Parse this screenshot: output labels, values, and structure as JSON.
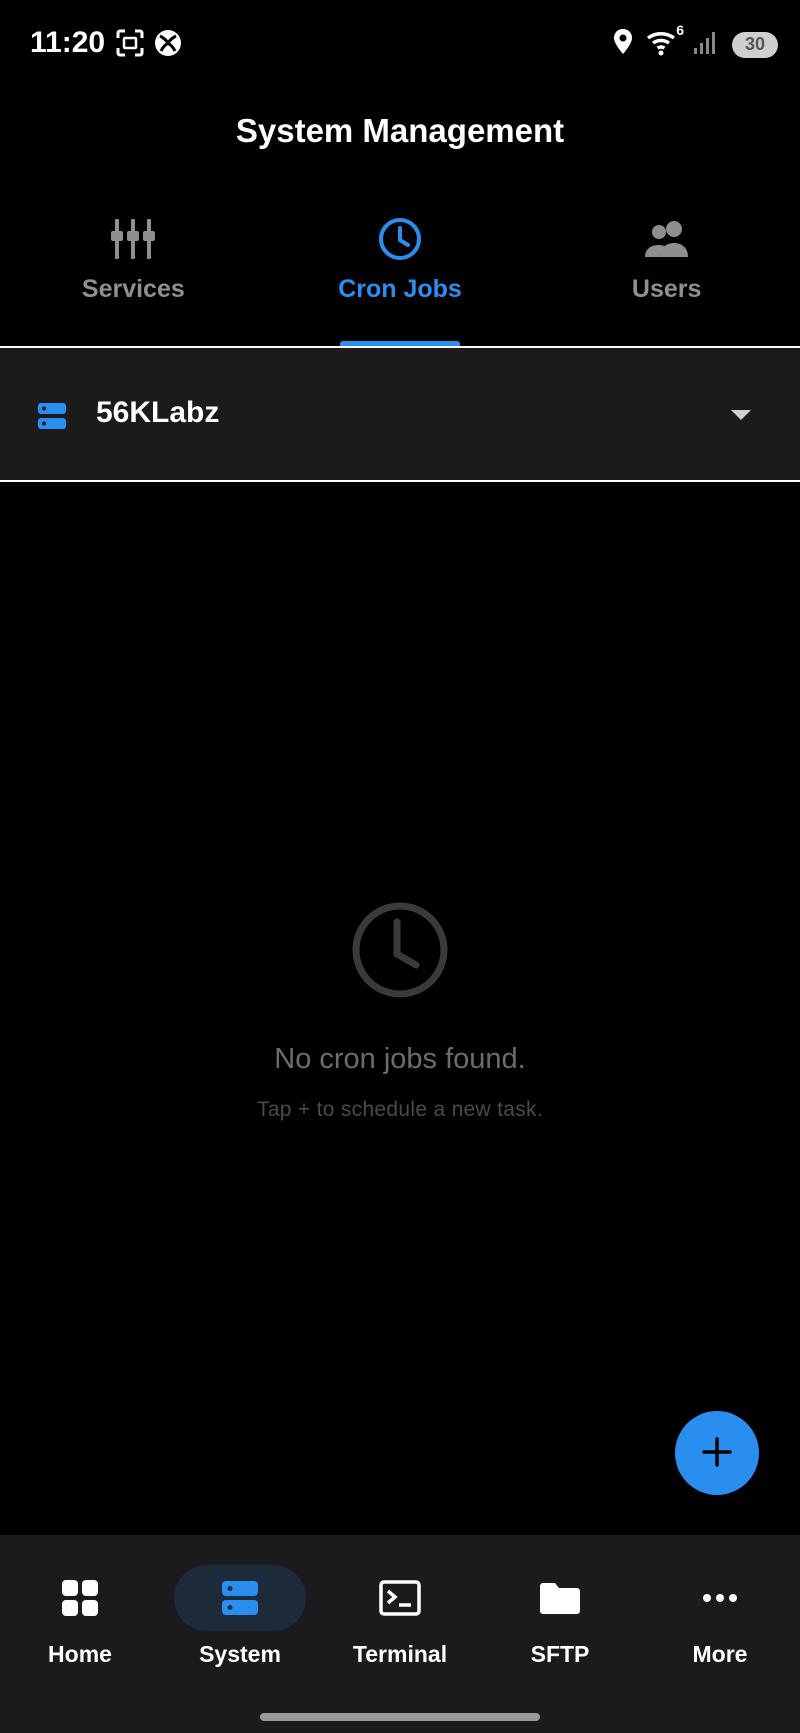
{
  "status_bar": {
    "time": "11:20",
    "battery": "30",
    "left_icons": [
      "screenshot-icon",
      "xbox-icon"
    ],
    "right_icons": [
      "location-icon",
      "wifi-icon",
      "signal-icon",
      "battery-icon"
    ],
    "wifi_badge": "6"
  },
  "header": {
    "title": "System Management"
  },
  "tabs": [
    {
      "label": "Services",
      "icon": "services-icon",
      "active": false
    },
    {
      "label": "Cron Jobs",
      "icon": "clock-icon",
      "active": true
    },
    {
      "label": "Users",
      "icon": "users-icon",
      "active": false
    }
  ],
  "server_selector": {
    "name": "56KLabz",
    "icon": "server-icon"
  },
  "empty_state": {
    "title": "No cron jobs found.",
    "subtitle": "Tap + to schedule a new task.",
    "icon": "clock-icon"
  },
  "fab": {
    "icon": "plus-icon"
  },
  "bottom_nav": {
    "items": [
      {
        "label": "Home",
        "icon": "grid-icon",
        "active": false
      },
      {
        "label": "System",
        "icon": "server-icon",
        "active": true
      },
      {
        "label": "Terminal",
        "icon": "terminal-icon",
        "active": false
      },
      {
        "label": "SFTP",
        "icon": "folder-icon",
        "active": false
      },
      {
        "label": "More",
        "icon": "more-icon",
        "active": false
      }
    ]
  },
  "colors": {
    "accent": "#2a8ef0",
    "background": "#000000",
    "surface": "#1b1b1d",
    "inactive": "#8f8f8f"
  }
}
